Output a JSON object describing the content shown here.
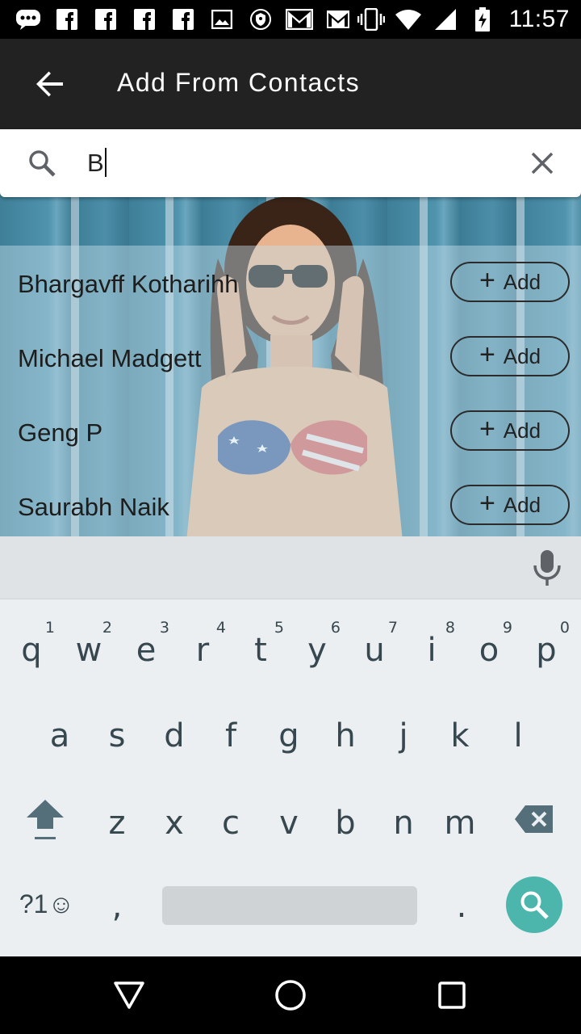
{
  "status_bar": {
    "time": "11:57",
    "left_icons": [
      "chat-icon",
      "facebook-icon",
      "facebook-icon",
      "facebook-icon",
      "facebook-icon",
      "image-icon",
      "shield-icon",
      "gmail-icon",
      "gmail-icon"
    ],
    "right_icons": [
      "vibrate-icon",
      "wifi-icon",
      "signal-icon",
      "battery-charging-icon"
    ]
  },
  "app_bar": {
    "title": "Add From Contacts"
  },
  "search": {
    "value": "B",
    "placeholder": ""
  },
  "contacts": [
    {
      "name": "Bhargavff Kotharihh",
      "action": "Add"
    },
    {
      "name": "Michael Madgett",
      "action": "Add"
    },
    {
      "name": "Geng P",
      "action": "Add"
    },
    {
      "name": "Saurabh Naik",
      "action": "Add"
    }
  ],
  "keyboard": {
    "row1": [
      {
        "key": "q",
        "hint": "1"
      },
      {
        "key": "w",
        "hint": "2"
      },
      {
        "key": "e",
        "hint": "3"
      },
      {
        "key": "r",
        "hint": "4"
      },
      {
        "key": "t",
        "hint": "5"
      },
      {
        "key": "y",
        "hint": "6"
      },
      {
        "key": "u",
        "hint": "7"
      },
      {
        "key": "i",
        "hint": "8"
      },
      {
        "key": "o",
        "hint": "9"
      },
      {
        "key": "p",
        "hint": "0"
      }
    ],
    "row2": [
      "a",
      "s",
      "d",
      "f",
      "g",
      "h",
      "j",
      "k",
      "l"
    ],
    "row3": [
      "z",
      "x",
      "c",
      "v",
      "b",
      "n",
      "m"
    ],
    "symbols_label": "?1☺",
    "comma": ",",
    "period": ".",
    "accent_color": "#4db6ac"
  },
  "colors": {
    "app_bar": "#222222",
    "status_bar": "#000000",
    "keyboard_bg": "#eceff1"
  }
}
